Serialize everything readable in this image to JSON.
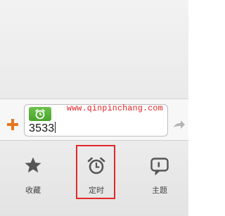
{
  "input": {
    "value": "3533",
    "timer_chip_icon": "alarm-clock-icon"
  },
  "input_bar": {
    "plus_icon": "plus-icon",
    "send_icon": "send-arrow-icon"
  },
  "watermark": {
    "text": "www.qinpinchang.com"
  },
  "toolbar": {
    "items": [
      {
        "label": "收藏",
        "icon": "star-icon"
      },
      {
        "label": "定时",
        "icon": "alarm-clock-icon"
      },
      {
        "label": "主题",
        "icon": "speech-bubble-icon"
      }
    ]
  },
  "colors": {
    "plus": "#e8751a",
    "timer_chip": "#5ab53a",
    "highlight": "#e02a2a",
    "icon": "#555555"
  }
}
